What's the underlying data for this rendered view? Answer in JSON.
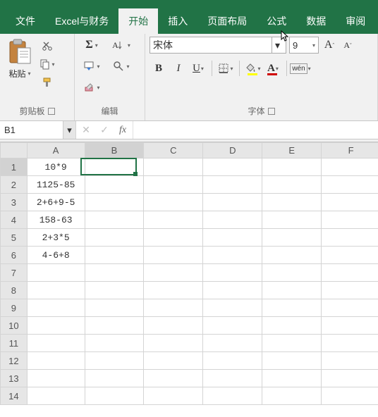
{
  "menu": {
    "items": [
      "文件",
      "Excel与财务",
      "开始",
      "插入",
      "页面布局",
      "公式",
      "数据",
      "审阅"
    ],
    "active_index": 2
  },
  "ribbon": {
    "clipboard": {
      "paste": "粘贴",
      "label": "剪贴板"
    },
    "editing": {
      "label": "编辑"
    },
    "font": {
      "name": "宋体",
      "size": "9",
      "grow": "A",
      "shrink": "A",
      "bold": "B",
      "italic": "I",
      "underline": "U",
      "wen": "wén",
      "label": "字体"
    }
  },
  "formula_bar": {
    "cell_ref": "B1",
    "fx": "fx",
    "value": ""
  },
  "grid": {
    "columns": [
      "A",
      "B",
      "C",
      "D",
      "E",
      "F"
    ],
    "rows": [
      {
        "n": "1",
        "A": "10*9"
      },
      {
        "n": "2",
        "A": "1125-85"
      },
      {
        "n": "3",
        "A": "2+6+9-5"
      },
      {
        "n": "4",
        "A": "158-63"
      },
      {
        "n": "5",
        "A": "2+3*5"
      },
      {
        "n": "6",
        "A": "4-6+8"
      },
      {
        "n": "7"
      },
      {
        "n": "8"
      },
      {
        "n": "9"
      },
      {
        "n": "10"
      },
      {
        "n": "11"
      },
      {
        "n": "12"
      },
      {
        "n": "13"
      },
      {
        "n": "14"
      }
    ],
    "selected": {
      "col": "B",
      "row": 1
    }
  }
}
